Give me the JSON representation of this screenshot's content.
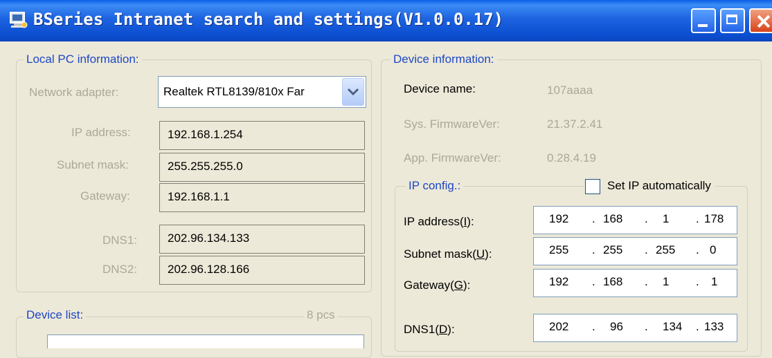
{
  "window": {
    "title": "BSeries Intranet search and settings(V1.0.0.17)"
  },
  "local_pc": {
    "legend": "Local PC information:",
    "network_adapter_label": "Network adapter:",
    "network_adapter_value": "Realtek RTL8139/810x Far",
    "ip_label": "IP address:",
    "ip_value": "192.168.1.254",
    "mask_label": "Subnet mask:",
    "mask_value": "255.255.255.0",
    "gateway_label": "Gateway:",
    "gateway_value": "192.168.1.1",
    "dns1_label": "DNS1:",
    "dns1_value": "202.96.134.133",
    "dns2_label": "DNS2:",
    "dns2_value": "202.96.128.166"
  },
  "device_list": {
    "legend": "Device list:",
    "count": "8 pcs"
  },
  "device_info": {
    "legend": "Device information:",
    "name_label": "Device name:",
    "name_value": "107aaaa",
    "sys_fw_label": "Sys. FirmwareVer:",
    "sys_fw_value": "21.37.2.41",
    "app_fw_label": "App. FirmwareVer:",
    "app_fw_value": "0.28.4.19"
  },
  "ip_config": {
    "legend": "IP config.:",
    "auto_label": "Set IP automatically",
    "auto_checked": false,
    "ip_label_pre": "IP address(",
    "ip_key": "I",
    "ip_label_post": "):",
    "mask_label_pre": "Subnet mask(",
    "mask_key": "U",
    "mask_label_post": "):",
    "gw_label_pre": "Gateway(",
    "gw_key": "G",
    "gw_label_post": "):",
    "dns1_label_pre": "DNS1(",
    "dns1_key": "D",
    "dns1_label_post": "):",
    "ip": {
      "o1": "192",
      "o2": "168",
      "o3": "1",
      "o4": "178"
    },
    "mask": {
      "o1": "255",
      "o2": "255",
      "o3": "255",
      "o4": "0"
    },
    "gateway": {
      "o1": "192",
      "o2": "168",
      "o3": "1",
      "o4": "1"
    },
    "dns1": {
      "o1": "202",
      "o2": "96",
      "o3": "134",
      "o4": "133"
    },
    "dot": "."
  },
  "icons": {
    "app": "network-settings-icon",
    "combo_arrow": "chevron-down-icon"
  },
  "colors": {
    "titlebar": "#0b4fd0",
    "legend": "#1d47c6",
    "disabled_text": "#a9a99a",
    "face": "#ece9d8"
  }
}
